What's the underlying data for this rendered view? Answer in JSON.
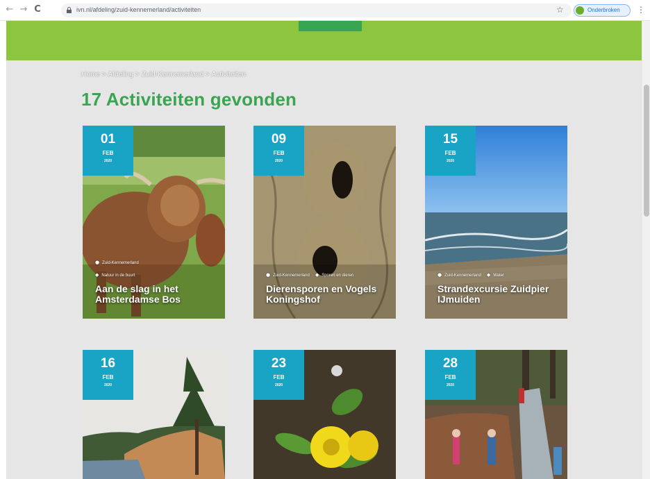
{
  "browser": {
    "url": "ivn.nl/afdeling/zuid-kennemerland/activiteiten",
    "profile_label": "Onderbroken",
    "nav_back": "←",
    "nav_forward": "→",
    "nav_reload": "C",
    "star": "☆",
    "menu": "⋮"
  },
  "breadcrumb": "Home > Afdeling > Zuid-Kennemerland > Activiteiten",
  "page_title": "17 Activiteiten gevonden",
  "colors": {
    "banner_green": "#8cc63f",
    "title_green": "#3aa551",
    "date_badge": "#19a3c4"
  },
  "cards": [
    {
      "day": "01",
      "month": "FEB",
      "year": "2020",
      "location": "Zuid-Kennemerland",
      "category": "Natuur in de buurt",
      "title": "Aan de slag in het Amsterdamse Bos",
      "image": "highland-cattle-photo"
    },
    {
      "day": "09",
      "month": "FEB",
      "year": "2020",
      "location": "Zuid-Kennemerland",
      "category": "Sporen en dieren",
      "title": "Dierensporen en Vogels Koningshof",
      "image": "woodpecker-holes-tree-photo"
    },
    {
      "day": "15",
      "month": "FEB",
      "year": "2020",
      "location": "Zuid-Kennemerland",
      "category": "Water",
      "title": "Strandexcursie Zuidpier IJmuiden",
      "image": "beach-sea-photo"
    },
    {
      "day": "16",
      "month": "FEB",
      "year": "2020",
      "image": "dunes-lake-pine-photo"
    },
    {
      "day": "23",
      "month": "FEB",
      "year": "2020",
      "image": "winter-aconite-flower-photo"
    },
    {
      "day": "28",
      "month": "FEB",
      "year": "2020",
      "image": "forest-stream-volunteers-photo"
    }
  ]
}
